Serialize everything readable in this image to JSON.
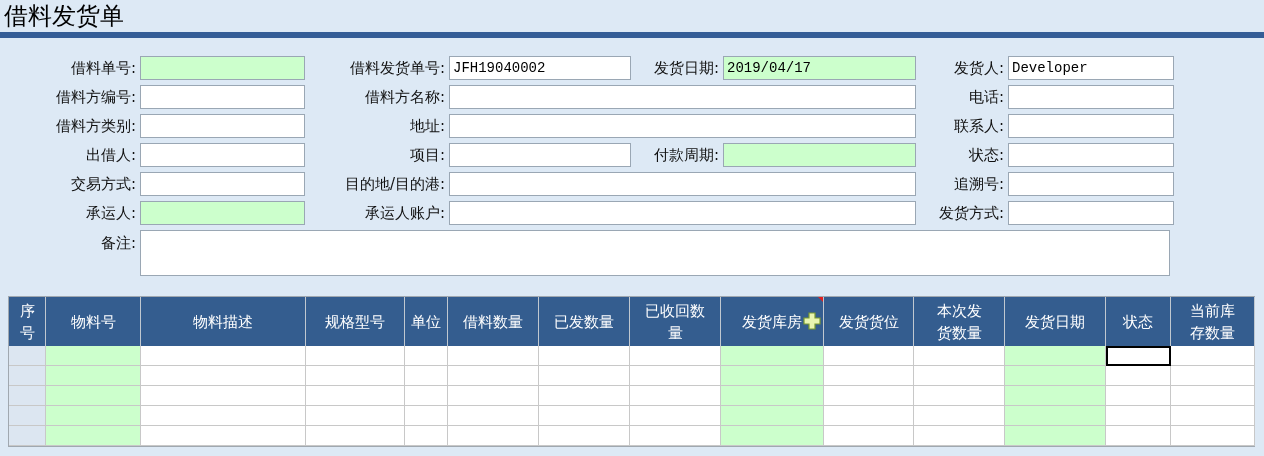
{
  "title": "借料发货单",
  "form": {
    "rows": [
      {
        "fields": [
          {
            "label": "借料单号:",
            "required": true,
            "kind": "short"
          },
          {
            "label": "借料发货单号:",
            "value": "JFH19040002",
            "required": false,
            "kind": "short"
          },
          {
            "label": "发货日期:",
            "value": "2019/04/17",
            "required": true,
            "kind": "short"
          },
          {
            "label": "发货人:",
            "value": "Developer",
            "required": false,
            "kind": "short"
          }
        ]
      },
      {
        "fields": [
          {
            "label": "借料方编号:",
            "required": false,
            "kind": "short"
          },
          {
            "label": "借料方名称:",
            "required": false,
            "kind": "wide"
          },
          {
            "label": "电话:",
            "required": false,
            "kind": "short"
          }
        ]
      },
      {
        "fields": [
          {
            "label": "借料方类别:",
            "required": false,
            "kind": "short"
          },
          {
            "label": "地址:",
            "required": false,
            "kind": "wide"
          },
          {
            "label": "联系人:",
            "required": false,
            "kind": "short"
          }
        ]
      },
      {
        "fields": [
          {
            "label": "出借人:",
            "required": false,
            "kind": "short"
          },
          {
            "label": "项目:",
            "required": false,
            "kind": "short"
          },
          {
            "label": "付款周期:",
            "required": true,
            "kind": "short"
          },
          {
            "label": "状态:",
            "required": false,
            "kind": "short"
          }
        ]
      },
      {
        "fields": [
          {
            "label": "交易方式:",
            "required": false,
            "kind": "short"
          },
          {
            "label": "目的地/目的港:",
            "required": false,
            "kind": "wide"
          },
          {
            "label": "追溯号:",
            "required": false,
            "kind": "short"
          }
        ]
      },
      {
        "fields": [
          {
            "label": "承运人:",
            "required": true,
            "kind": "short"
          },
          {
            "label": "承运人账户:",
            "required": false,
            "kind": "wide"
          },
          {
            "label": "发货方式:",
            "required": false,
            "kind": "short"
          }
        ]
      }
    ],
    "remark": {
      "label": "备注:"
    }
  },
  "table": {
    "columns": [
      {
        "label": "序号",
        "kind": "index",
        "has_comment": false
      },
      {
        "label": "物料号",
        "required": true,
        "has_comment": false
      },
      {
        "label": "物料描述",
        "required": false,
        "has_comment": false
      },
      {
        "label": "规格型号",
        "required": false,
        "has_comment": false
      },
      {
        "label": "单位",
        "required": false,
        "has_comment": false
      },
      {
        "label": "借料数量",
        "required": false,
        "has_comment": false
      },
      {
        "label": "已发数量",
        "required": false,
        "has_comment": false
      },
      {
        "label": "已收回数量",
        "required": false,
        "has_comment": false
      },
      {
        "label": "发货库房",
        "required": true,
        "has_comment": true
      },
      {
        "label": "发货货位",
        "required": false,
        "has_comment": false
      },
      {
        "label": "本次发货数量",
        "required": false,
        "has_comment": false
      },
      {
        "label": "发货日期",
        "required": true,
        "has_comment": false
      },
      {
        "label": "状态",
        "required": false,
        "has_comment": false
      },
      {
        "label": "当前库存数量",
        "required": false,
        "has_comment": false
      }
    ],
    "rows": [
      {
        "cells": [
          {
            "selected": false
          },
          {
            "selected": false
          },
          {
            "selected": false
          },
          {
            "selected": false
          },
          {
            "selected": false
          },
          {
            "selected": false
          },
          {
            "selected": false
          },
          {
            "selected": false
          },
          {
            "selected": false
          },
          {
            "selected": false
          },
          {
            "selected": false
          },
          {
            "selected": false
          },
          {
            "selected": true
          },
          {
            "selected": false
          }
        ]
      },
      {
        "cells": [
          {
            "selected": false
          },
          {
            "selected": false
          },
          {
            "selected": false
          },
          {
            "selected": false
          },
          {
            "selected": false
          },
          {
            "selected": false
          },
          {
            "selected": false
          },
          {
            "selected": false
          },
          {
            "selected": false
          },
          {
            "selected": false
          },
          {
            "selected": false
          },
          {
            "selected": false
          },
          {
            "selected": false
          },
          {
            "selected": false
          }
        ]
      },
      {
        "cells": [
          {
            "selected": false
          },
          {
            "selected": false
          },
          {
            "selected": false
          },
          {
            "selected": false
          },
          {
            "selected": false
          },
          {
            "selected": false
          },
          {
            "selected": false
          },
          {
            "selected": false
          },
          {
            "selected": false
          },
          {
            "selected": false
          },
          {
            "selected": false
          },
          {
            "selected": false
          },
          {
            "selected": false
          },
          {
            "selected": false
          }
        ]
      },
      {
        "cells": [
          {
            "selected": false
          },
          {
            "selected": false
          },
          {
            "selected": false
          },
          {
            "selected": false
          },
          {
            "selected": false
          },
          {
            "selected": false
          },
          {
            "selected": false
          },
          {
            "selected": false
          },
          {
            "selected": false
          },
          {
            "selected": false
          },
          {
            "selected": false
          },
          {
            "selected": false
          },
          {
            "selected": false
          },
          {
            "selected": false
          }
        ]
      },
      {
        "cells": [
          {
            "selected": false
          },
          {
            "selected": false
          },
          {
            "selected": false
          },
          {
            "selected": false
          },
          {
            "selected": false
          },
          {
            "selected": false
          },
          {
            "selected": false
          },
          {
            "selected": false
          },
          {
            "selected": false
          },
          {
            "selected": false
          },
          {
            "selected": false
          },
          {
            "selected": false
          },
          {
            "selected": false
          },
          {
            "selected": false
          }
        ]
      }
    ]
  }
}
